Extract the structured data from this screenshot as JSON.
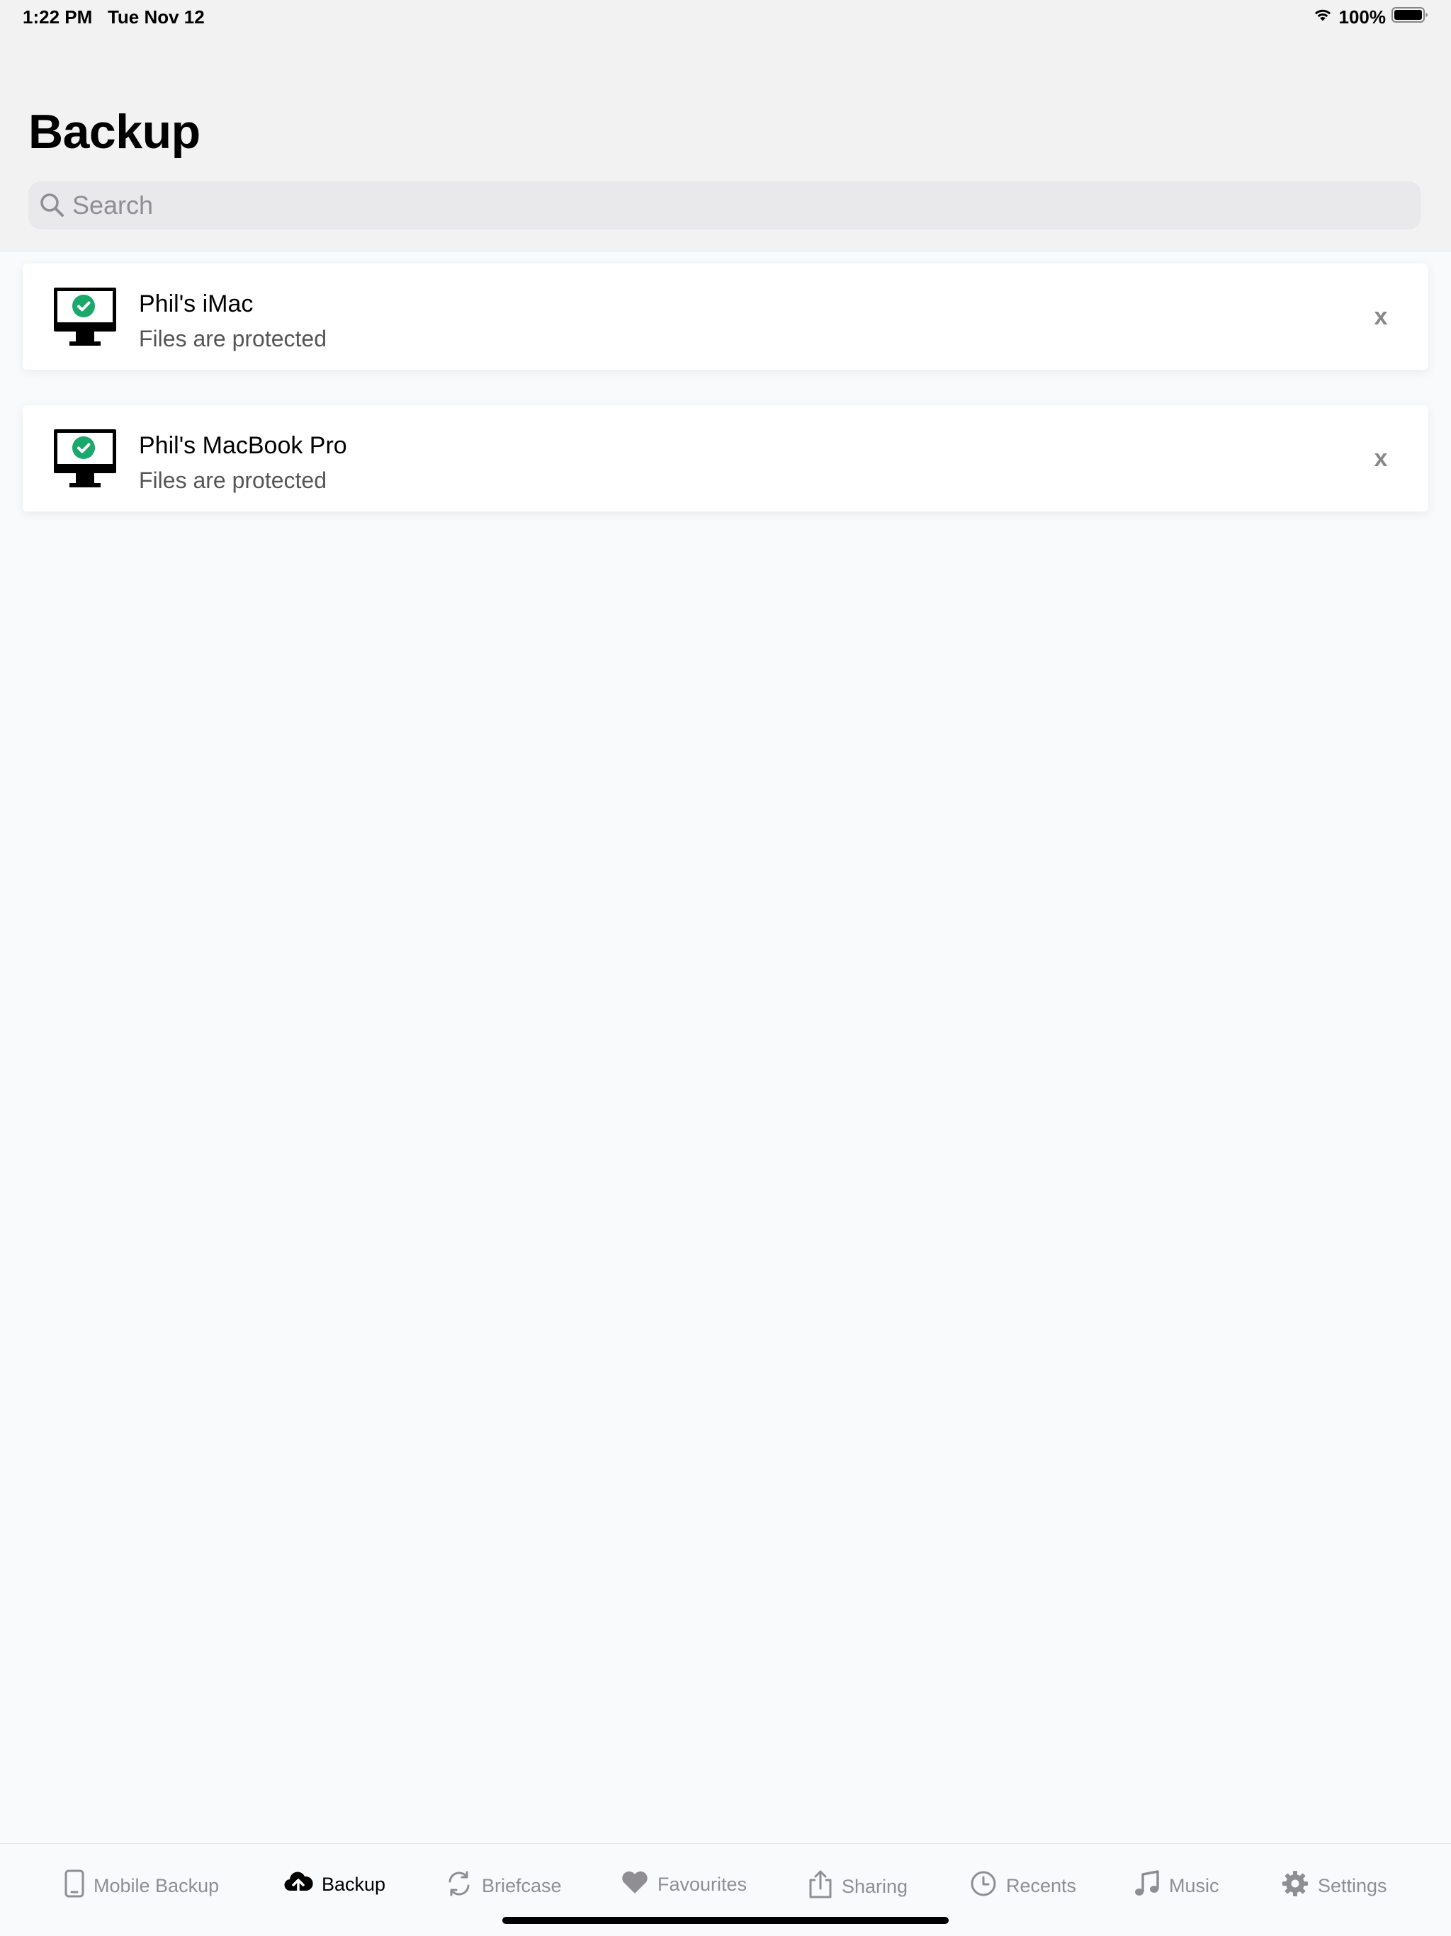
{
  "status_bar": {
    "time": "1:22 PM",
    "date": "Tue Nov 12",
    "battery": "100%",
    "wifi_icon": "wifi-icon",
    "battery_icon": "battery-icon"
  },
  "header": {
    "title": "Backup",
    "search": {
      "placeholder": "Search",
      "value": ""
    }
  },
  "devices": [
    {
      "name": "Phil's iMac",
      "status": "Files are protected",
      "icon": "monitor-check-icon",
      "close_label": "x"
    },
    {
      "name": "Phil's MacBook Pro",
      "status": "Files are protected",
      "icon": "monitor-check-icon",
      "close_label": "x"
    }
  ],
  "tabs": [
    {
      "label": "Mobile Backup",
      "icon": "phone-icon",
      "active": false
    },
    {
      "label": "Backup",
      "icon": "cloud-upload-icon",
      "active": true
    },
    {
      "label": "Briefcase",
      "icon": "sync-icon",
      "active": false
    },
    {
      "label": "Favourites",
      "icon": "heart-icon",
      "active": false
    },
    {
      "label": "Sharing",
      "icon": "share-icon",
      "active": false
    },
    {
      "label": "Recents",
      "icon": "clock-icon",
      "active": false
    },
    {
      "label": "Music",
      "icon": "music-note-icon",
      "active": false
    },
    {
      "label": "Settings",
      "icon": "gear-icon",
      "active": false
    }
  ],
  "colors": {
    "protected_check": "#1aa86b",
    "header_bg": "#f2f2f2",
    "page_bg": "#f9fafc",
    "inactive_tab": "#8e8e93"
  }
}
